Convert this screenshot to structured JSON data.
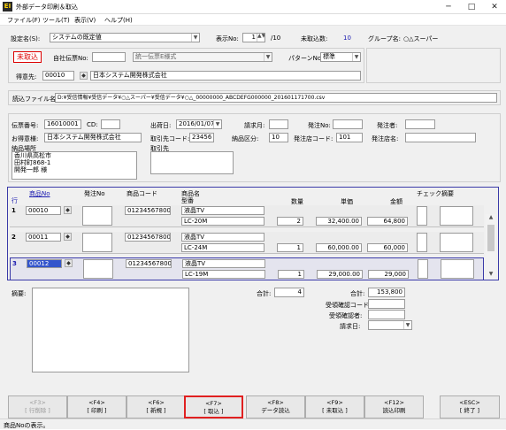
{
  "window": {
    "title": "外部データ印刷＆取込",
    "icon_text": "EI",
    "min": "─",
    "max": "□",
    "close": "✕"
  },
  "menu": [
    "ファイル(F)",
    "ツール(T)",
    "表示(V)",
    "ヘルプ(H)"
  ],
  "top": {
    "setting_label": "設定名(S):",
    "setting_value": "システムの既定値",
    "display_no_label": "表示No:",
    "display_no_value": "1",
    "display_no_total": "/10",
    "untaken_label": "未取込数:",
    "untaken_value": "10",
    "group_label": "グループ名:",
    "group_value": "○△スーパー"
  },
  "header": {
    "status_badge": "未取込",
    "company_slip_label": "自社伝票No:",
    "company_slip_value": "",
    "slip_format_value": "統一伝票E様式",
    "pattern_label": "パターンNo:",
    "pattern_value": "標準",
    "customer_label": "得意先:",
    "customer_code": "00010",
    "customer_name": "日本システム開発株式会社"
  },
  "file": {
    "label": "読込ファイル名:",
    "value": "D:¥受信情報¥受信データ¥○△スーパー¥受信データ¥○△_00000000_ABCDEFG000000_201601171700.csv"
  },
  "info": {
    "slip_no_label": "伝票番号:",
    "slip_no_value": "16010001",
    "cd_label": "CD:",
    "cd_value": "",
    "ship_date_label": "出荷日:",
    "ship_date_value": "2016/01/07",
    "billing_month_label": "請求月:",
    "billing_month_value": "",
    "order_no_label": "発注No:",
    "order_no_value": "",
    "orderer_label": "発注者:",
    "orderer_value": "",
    "customer_label": "お得意様:",
    "customer_value": "日本システム開発株式会社",
    "partner_code_label": "取引先コード:",
    "partner_code_value": "23456",
    "delivery_div_label": "納品区分:",
    "delivery_div_value": "10",
    "order_shop_code_label": "発注店コード:",
    "order_shop_code_value": "101",
    "order_shop_name_label": "発注店名:",
    "order_shop_name_value": "",
    "delivery_place_label": "納品場所",
    "delivery_place_lines": [
      "香川県高松市",
      "田村町868-1",
      "開発一郎 様"
    ],
    "partner_label": "取引先"
  },
  "columns": {
    "row": "行",
    "product_no": "商品No",
    "order_no": "発注No",
    "product_code": "商品コード",
    "product_name": "商品名",
    "model": "型番",
    "qty": "数量",
    "unit_price": "単価",
    "amount": "金額",
    "check": "チェック",
    "summary": "摘要"
  },
  "rows": [
    {
      "n": "1",
      "no": "00010",
      "code": "0123456780001",
      "name": "液晶TV",
      "model": "LC-20M",
      "qty": "2",
      "price": "32,400.00",
      "amount": "64,800"
    },
    {
      "n": "2",
      "no": "00011",
      "code": "0123456780002",
      "name": "液晶TV",
      "model": "LC-24M",
      "qty": "1",
      "price": "60,000.00",
      "amount": "60,000"
    },
    {
      "n": "3",
      "no": "00012",
      "code": "0123456780003",
      "name": "液晶TV",
      "model": "LC-19M",
      "qty": "1",
      "price": "29,000.00",
      "amount": "29,000"
    }
  ],
  "footer": {
    "summary_label": "摘要:",
    "subtotal_label": "合計:",
    "subtotal_value": "4",
    "total_label": "合計:",
    "total_value": "153,800",
    "confirm_code_label": "受領確認コード:",
    "confirm_code_value": "",
    "confirmer_label": "受領確認者:",
    "confirmer_value": "",
    "invoice_date_label": "請求日:",
    "invoice_date_value": ""
  },
  "fkeys": [
    {
      "key": "<F3>",
      "label": "[ 行削除 ]"
    },
    {
      "key": "<F4>",
      "label": "[ 印刷 ]"
    },
    {
      "key": "<F6>",
      "label": "[ 新規 ]"
    },
    {
      "key": "<F7>",
      "label": "[ 取込 ]"
    },
    {
      "key": "<F8>",
      "label": "データ読込"
    },
    {
      "key": "<F9>",
      "label": "[ 未取込 ]"
    },
    {
      "key": "<F12>",
      "label": "読込印刷"
    },
    {
      "key": "<ESC>",
      "label": "[ 終了 ]"
    }
  ],
  "status": {
    "text": "商品Noの表示。"
  },
  "colors": {
    "highlight": "#e02020",
    "accent_border": "#3a3aa8",
    "status_red": "#d00000"
  }
}
